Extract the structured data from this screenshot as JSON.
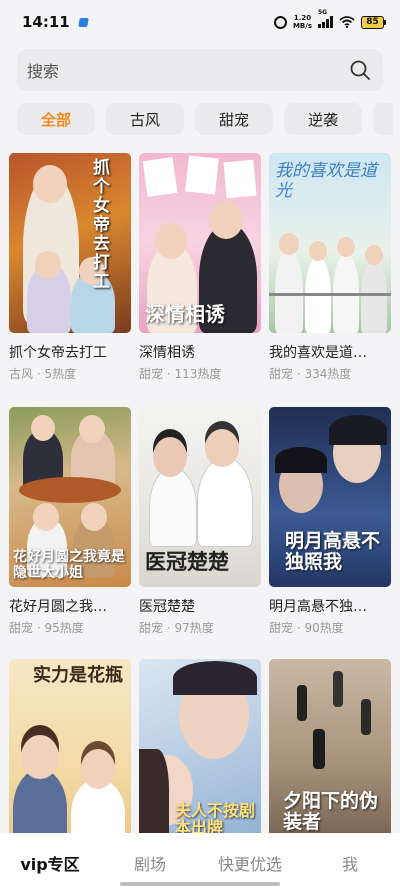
{
  "status": {
    "time": "14:11",
    "speed_value": "1.20",
    "speed_unit": "MB/s",
    "network": "5G",
    "battery": "85"
  },
  "search": {
    "placeholder": "搜索",
    "icon": "search-icon"
  },
  "tabs": [
    {
      "label": "全部",
      "active": true
    },
    {
      "label": "古风",
      "active": false
    },
    {
      "label": "甜宠",
      "active": false
    },
    {
      "label": "逆袭",
      "active": false
    }
  ],
  "dramas": [
    {
      "title": "抓个女帝去打工",
      "genre": "古风",
      "heat": "5热度",
      "poster_text": "抓个女帝去打工"
    },
    {
      "title": "深情相诱",
      "genre": "甜宠",
      "heat": "113热度",
      "poster_text": "深情相诱"
    },
    {
      "title": "我的喜欢是道…",
      "genre": "甜宠",
      "heat": "334热度",
      "poster_text": "我的喜欢是道光"
    },
    {
      "title": "花好月圆之我…",
      "genre": "甜宠",
      "heat": "95热度",
      "poster_text": "花好月圆之我竟是隐世大小姐"
    },
    {
      "title": "医冠楚楚",
      "genre": "甜宠",
      "heat": "97热度",
      "poster_text": "医冠楚楚"
    },
    {
      "title": "明月高悬不独…",
      "genre": "甜宠",
      "heat": "90热度",
      "poster_text": "明月高悬不独照我"
    },
    {
      "title": "",
      "genre": "",
      "heat": "",
      "poster_text": "实力是花瓶"
    },
    {
      "title": "",
      "genre": "",
      "heat": "",
      "poster_text": "夫人不按剧本出牌"
    },
    {
      "title": "",
      "genre": "",
      "heat": "",
      "poster_text": "夕阳下的伪装者"
    }
  ],
  "meta_separator": "·",
  "bottom_nav": [
    {
      "label": "vip专区",
      "active": true
    },
    {
      "label": "剧场",
      "active": false
    },
    {
      "label": "快更优选",
      "active": false
    },
    {
      "label": "我",
      "active": false
    }
  ],
  "colors": {
    "accent": "#f08a1c",
    "background": "#f4f4f6",
    "chip": "#ebebed"
  }
}
